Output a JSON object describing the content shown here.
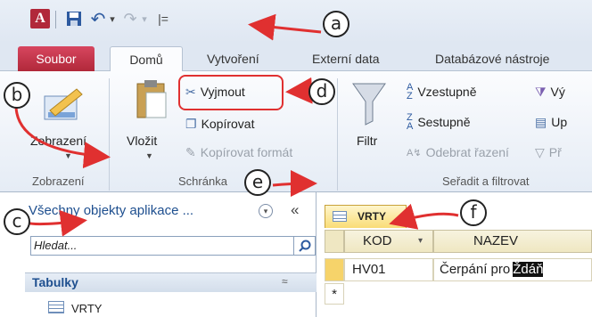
{
  "qat": {
    "undo_glyph": "↶",
    "redo_glyph": "↷",
    "dropdown": "▾",
    "customize": "|=",
    "app_logo": "A"
  },
  "tabs": [
    "Soubor",
    "Domů",
    "Vytvoření",
    "Externí data",
    "Databázové nástroje"
  ],
  "ribbon": {
    "views": {
      "label": "Zobrazení",
      "group": "Zobrazení"
    },
    "clipboard": {
      "paste": "Vložit",
      "cut": "Vyjmout",
      "copy": "Kopírovat",
      "format_painter": "Kopírovat formát",
      "group": "Schránka"
    },
    "sort_filter": {
      "filter": "Filtr",
      "asc": "Vzestupně",
      "desc": "Sestupně",
      "remove_sort": "Odebrat řazení",
      "selection": "Vý",
      "advanced": "Up",
      "toggle": "Př",
      "group": "Seřadit a filtrovat"
    }
  },
  "nav": {
    "title": "Všechny objekty aplikace ...",
    "collapse": "«",
    "search_placeholder": "Hledat...",
    "section": "Tabulky",
    "section_toggle": "≈",
    "item": "VRTY"
  },
  "datasheet": {
    "tab": "VRTY",
    "columns": [
      "KOD",
      "NAZEV"
    ],
    "rows": [
      {
        "kod": "HV01",
        "nazev_prefix": "Čerpání pro",
        "nazev_selected": "Ždáň"
      }
    ],
    "new_row": "*"
  },
  "callouts": [
    "a",
    "b",
    "c",
    "d",
    "e",
    "f"
  ],
  "colors": {
    "file_tab": "#b1283a",
    "callout_frame": "#e03030",
    "arrow": "#e03030"
  }
}
